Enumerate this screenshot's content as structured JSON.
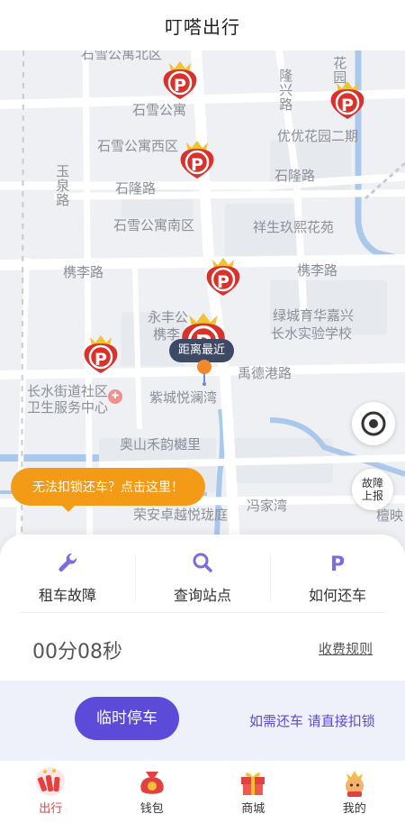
{
  "header": {
    "title": "叮嗒出行"
  },
  "map": {
    "labels": {
      "shixue_north": "石雪公寓北区",
      "shixue": "石雪公寓",
      "shixue_west": "石雪公寓西区",
      "shixue_south": "石雪公寓南区",
      "shilong_road_left": "石隆路",
      "shilong_road_right": "石隆路",
      "longxing_road": "隆兴路",
      "huayuan": "花园",
      "youyou": "优优花园二期",
      "yuquan_road": "玉泉路",
      "xiangsheng": "祥生玖熙花苑",
      "xieli_road_left": "槜李路",
      "xieli_road_right": "槜李路",
      "yongfeng": "永丰公",
      "xieli_short": "槜李",
      "lvcheng": "绿城育华嘉兴",
      "changshui_school": "长水实验学校",
      "yude_road": "禹德港路",
      "clinic_1": "长水街道社区",
      "clinic_2": "卫生服务中心",
      "zicheng": "紫城悦澜湾",
      "aoshan": "奥山禾韵樾里",
      "fengjia": "冯家湾",
      "rongan": "荣安卓越悦珑庭",
      "tanying": "檀映"
    },
    "pin_symbol": "P",
    "nearest_tag": "距离最近",
    "bubble": "无法扣锁还车？点击这里！",
    "report_line1": "故障",
    "report_line2": "上报"
  },
  "actions": [
    {
      "label": "租车故障",
      "icon": "wrench-icon"
    },
    {
      "label": "查询站点",
      "icon": "search-icon"
    },
    {
      "label": "如何还车",
      "icon": "parking-p-icon"
    }
  ],
  "timer": "00分08秒",
  "fee_rules": "收费规则",
  "temp_park": "临时停车",
  "return_hint": "如需还车 请直接扣锁",
  "tabs": [
    {
      "label": "出行",
      "icon": "firecracker-icon",
      "active": true
    },
    {
      "label": "钱包",
      "icon": "lucky-bag-icon",
      "active": false
    },
    {
      "label": "商城",
      "icon": "gift-box-icon",
      "active": false
    },
    {
      "label": "我的",
      "icon": "mascot-avatar-icon",
      "active": false
    }
  ],
  "colors": {
    "pin_red": "#d9312c",
    "pin_gold": "#f1c232",
    "accent_purple": "#5b4bd8",
    "bubble_orange": "#f39a17",
    "active_tab": "#e34040"
  }
}
